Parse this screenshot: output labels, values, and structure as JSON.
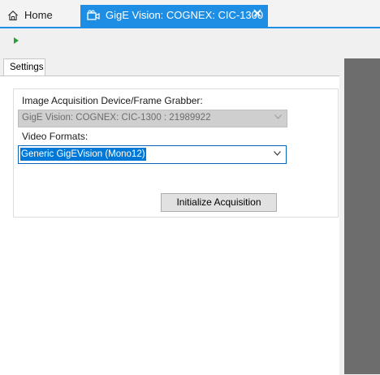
{
  "tabs": {
    "home_label": "Home",
    "active_label": "GigE Vision: COGNEX: CIC-1300",
    "close_glyph": "✕"
  },
  "settings_tab": {
    "label": "Settings"
  },
  "form": {
    "device_label": "Image Acquisition Device/Frame Grabber:",
    "device_value": "GigE Vision: COGNEX: CIC-1300 : 21989922",
    "format_label": "Video Formats:",
    "format_value": "Generic GigEVision (Mono12)",
    "init_button": "Initialize Acquisition"
  },
  "colors": {
    "accent": "#1e8ee5",
    "play": "#2e9e3a",
    "selection": "#0078d7",
    "right_panel": "#6d6d6d"
  }
}
